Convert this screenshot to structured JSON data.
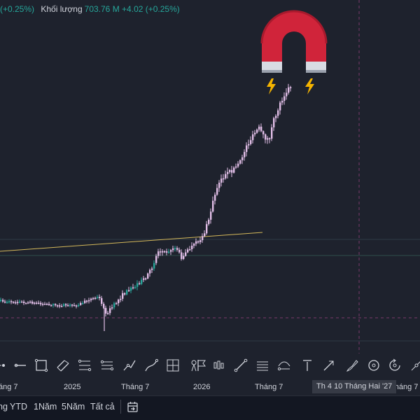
{
  "legend": {
    "price_change": "(+0.25%)",
    "volume_label": "Khối lượng",
    "volume_value": "703.76 M",
    "volume_change": "+4.02 (+0.25%)"
  },
  "time_axis": {
    "labels": [
      "áng 7",
      "2025",
      "Tháng 7",
      "2026",
      "Tháng 7",
      "Tháng 7"
    ],
    "crosshair_date": "Th 4 10 Tháng Hai '27"
  },
  "range_buttons": {
    "partial": "ng",
    "ytd": "YTD",
    "one_year": "1Năm",
    "five_years": "5Năm",
    "all": "Tất cả"
  },
  "colors": {
    "background": "#1e222d",
    "candle_body": "#e1bee7",
    "candle_up": "#26a69a",
    "trendline": "#d4b85a",
    "magnet_red": "#d0243a",
    "text": "#d1d4dc"
  },
  "drawing_tools": [
    "cursor-icon",
    "horizontal-line-icon",
    "rectangle-icon",
    "parallel-channel-icon",
    "fib-retracement-icon",
    "fib-extension-icon",
    "path-icon",
    "polyline-icon",
    "grid-icon",
    "pin-icon",
    "flag-icon",
    "bars-pattern-icon",
    "trend-line-icon",
    "horizontal-lines-icon",
    "regression-icon",
    "vertical-anchor-icon",
    "arrow-icon",
    "brush-icon",
    "circle-icon",
    "rotate-icon",
    "node-icon"
  ],
  "icons": {
    "magnet": "magnet-icon",
    "date_range": "calendar-range-icon"
  }
}
